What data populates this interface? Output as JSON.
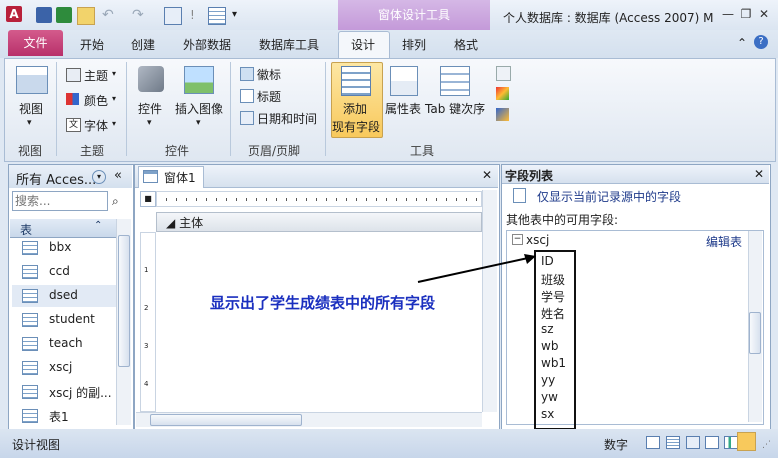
{
  "window": {
    "title": "个人数据库 : 数据库 (Access 2007) M",
    "context_tab": "窗体设计工具",
    "controls": {
      "minimize": "—",
      "restore": "❐",
      "close": "✕"
    }
  },
  "tabs": {
    "file": "文件",
    "home": "开始",
    "create": "创建",
    "external": "外部数据",
    "dbtools": "数据库工具",
    "design": "设计",
    "arrange": "排列",
    "format": "格式"
  },
  "ribbon": {
    "view": {
      "label": "视图",
      "group": "视图"
    },
    "theme": {
      "themes": "主题",
      "colors": "颜色",
      "fonts": "字体",
      "group": "主题"
    },
    "controls": {
      "controls": "控件",
      "insert_image": "插入图像",
      "group": "控件"
    },
    "header": {
      "logo": "徽标",
      "title": "标题",
      "datetime": "日期和时间",
      "group": "页眉/页脚"
    },
    "tools": {
      "add_field_1": "添加",
      "add_field_2": "现有字段",
      "property": "属性表",
      "tab_order": "Tab 键次序",
      "group": "工具"
    }
  },
  "nav": {
    "header": "所有 Acces...",
    "search_placeholder": "搜索...",
    "section": "表",
    "items": [
      "bbx",
      "ccd",
      "dsed",
      "student",
      "teach",
      "xscj",
      "xscj 的副...",
      "表1"
    ],
    "selected": "dsed"
  },
  "form": {
    "tab": "窗体1",
    "section": "主体",
    "annotation": "显示出了学生成绩表中的所有字段",
    "v_ruler": [
      "1",
      "2",
      "3",
      "4"
    ]
  },
  "field_list": {
    "title": "字段列表",
    "only_current": "仅显示当前记录源中的字段",
    "other_tables": "其他表中的可用字段:",
    "table": "xscj",
    "edit_table": "编辑表",
    "fields": [
      "ID",
      "班级",
      "学号",
      "姓名",
      "sz",
      "wb",
      "wb1",
      "yy",
      "yw",
      "sx"
    ]
  },
  "status": {
    "left": "设计视图",
    "mode": "数字"
  },
  "colors": {
    "file_tab": "#b8306a",
    "context_tab": "#c49ad9",
    "annotation": "#1a2fbf",
    "highlight": "#f8c95c"
  }
}
